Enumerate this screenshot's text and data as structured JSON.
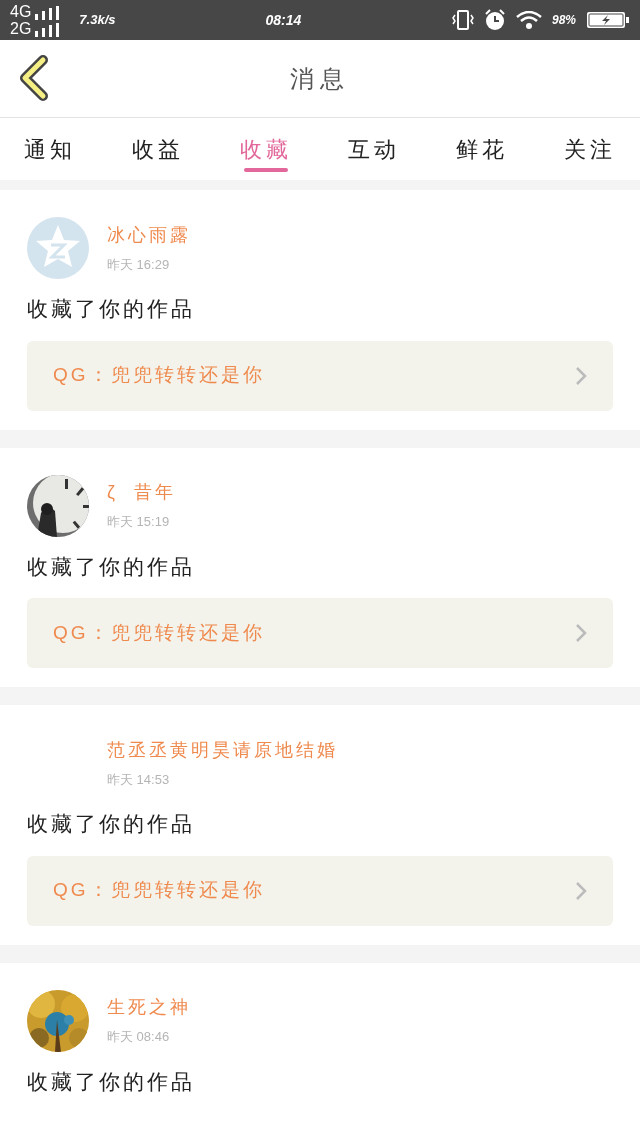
{
  "status_bar": {
    "network_1": "4G",
    "network_2": "2G",
    "speed": "7.3k/s",
    "time": "08:14",
    "battery": "98%"
  },
  "header": {
    "title": "消息"
  },
  "tabs": [
    {
      "label": "通知",
      "selected": false
    },
    {
      "label": "收益",
      "selected": false
    },
    {
      "label": "收藏",
      "selected": true
    },
    {
      "label": "互动",
      "selected": false
    },
    {
      "label": "鲜花",
      "selected": false
    },
    {
      "label": "关注",
      "selected": false
    }
  ],
  "messages": [
    {
      "avatar": {
        "kind": "default"
      },
      "name": "冰心雨露",
      "time": "昨天 16:29",
      "action": "收藏了你的作品",
      "work": "QG：兜兜转转还是你"
    },
    {
      "avatar": {
        "kind": "clock"
      },
      "name": "ζ  昔年",
      "time": "昨天 15:19",
      "action": "收藏了你的作品",
      "work": "QG：兜兜转转还是你"
    },
    {
      "avatar": {
        "kind": "none"
      },
      "name": "范丞丞黄明昊请原地结婚",
      "time": "昨天 14:53",
      "action": "收藏了你的作品",
      "work": "QG：兜兜转转还是你"
    },
    {
      "avatar": {
        "kind": "tree"
      },
      "name": "生死之神",
      "time": "昨天 08:46",
      "action": "收藏了你的作品"
    }
  ]
}
